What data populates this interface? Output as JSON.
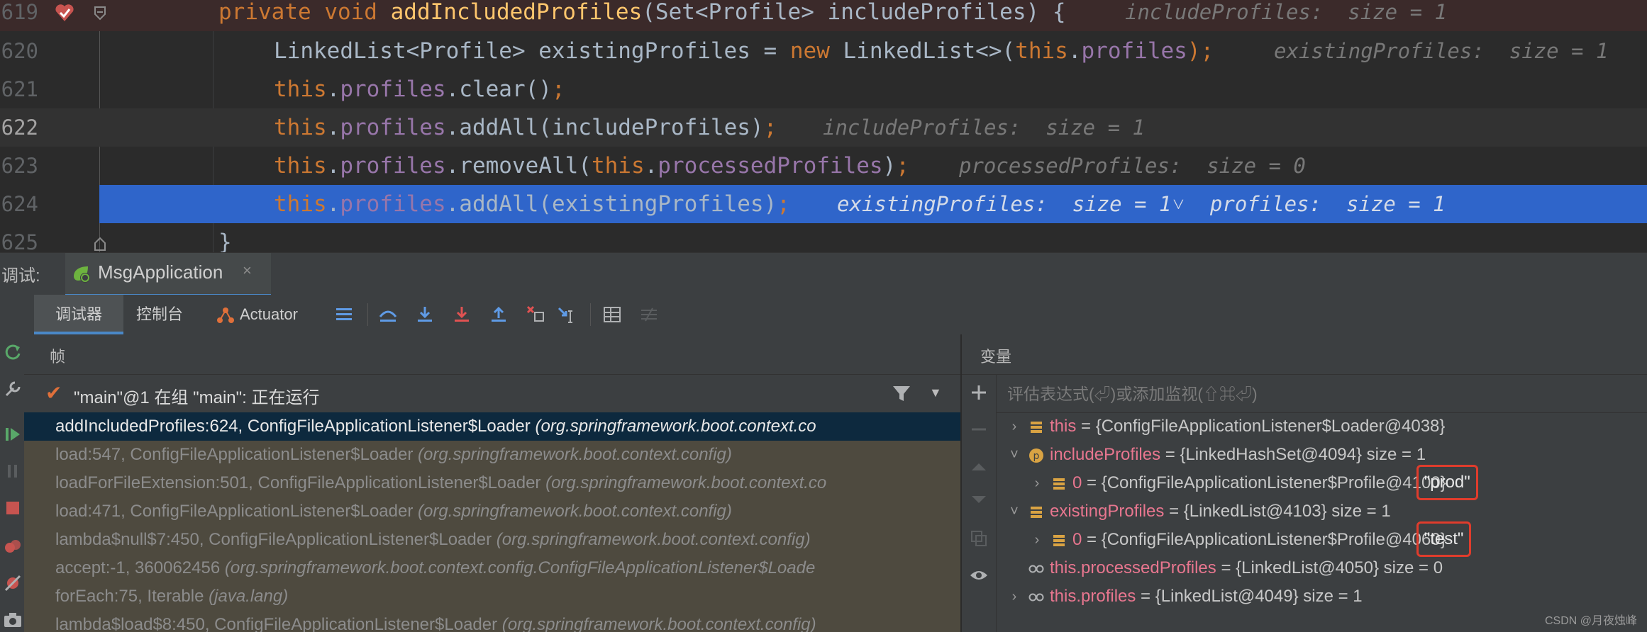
{
  "editor": {
    "lines": [
      {
        "num": "619",
        "code": [
          {
            "t": "private ",
            "c": "kw"
          },
          {
            "t": "void ",
            "c": "kw"
          },
          {
            "t": "addIncludedProfiles",
            "c": "fn"
          },
          {
            "t": "(Set<Profile> includeProfiles) {",
            "c": "plain"
          }
        ],
        "hint": "includeProfiles:  size = 1"
      },
      {
        "num": "620",
        "code": [
          {
            "t": "LinkedList<Profile> existingProfiles = ",
            "c": "plain"
          },
          {
            "t": "new ",
            "c": "kw"
          },
          {
            "t": "LinkedList<>(",
            "c": "plain"
          },
          {
            "t": "this",
            "c": "kw"
          },
          {
            "t": ".",
            "c": "plain"
          },
          {
            "t": "profiles",
            "c": "fld"
          },
          {
            "t": ");",
            "c": "kw"
          }
        ],
        "hint": "existingProfiles:  size = 1"
      },
      {
        "num": "621",
        "code": [
          {
            "t": "this",
            "c": "kw"
          },
          {
            "t": ".",
            "c": "plain"
          },
          {
            "t": "profiles",
            "c": "fld"
          },
          {
            "t": ".clear()",
            "c": "plain"
          },
          {
            "t": ";",
            "c": "kw"
          }
        ],
        "hint": ""
      },
      {
        "num": "622",
        "code": [
          {
            "t": "this",
            "c": "kw"
          },
          {
            "t": ".",
            "c": "plain"
          },
          {
            "t": "profiles",
            "c": "fld"
          },
          {
            "t": ".addAll(includeProfiles)",
            "c": "plain"
          },
          {
            "t": ";",
            "c": "kw"
          }
        ],
        "hint": "includeProfiles:  size = 1"
      },
      {
        "num": "623",
        "code": [
          {
            "t": "this",
            "c": "kw"
          },
          {
            "t": ".",
            "c": "plain"
          },
          {
            "t": "profiles",
            "c": "fld"
          },
          {
            "t": ".removeAll(",
            "c": "plain"
          },
          {
            "t": "this",
            "c": "kw"
          },
          {
            "t": ".",
            "c": "plain"
          },
          {
            "t": "processedProfiles",
            "c": "fld"
          },
          {
            "t": ")",
            "c": "plain"
          },
          {
            "t": ";",
            "c": "kw"
          }
        ],
        "hint": "processedProfiles:  size = 0"
      },
      {
        "num": "624",
        "code": [
          {
            "t": "this",
            "c": "kw"
          },
          {
            "t": ".",
            "c": "plain"
          },
          {
            "t": "profiles",
            "c": "fld"
          },
          {
            "t": ".addAll(existingProfiles)",
            "c": "plain"
          },
          {
            "t": ";",
            "c": "kw"
          }
        ],
        "hint": "existingProfiles:  size = 1˅  profiles:  size = 1"
      },
      {
        "num": "625",
        "code": [
          {
            "t": "}",
            "c": "plain"
          }
        ],
        "hint": ""
      }
    ]
  },
  "debug": {
    "label": "调试:",
    "session_tab": "MsgApplication",
    "session_close": "×",
    "tabs": {
      "debugger": "调试器",
      "console": "控制台",
      "actuator": "Actuator"
    }
  },
  "frames": {
    "title": "帧",
    "thread": "\"main\"@1 在组 \"main\": 正在运行",
    "items": [
      {
        "method": "addIncludedProfiles:624, ConfigFileApplicationListener$Loader",
        "pkg": "(org.springframework.boot.context.co"
      },
      {
        "method": "load:547, ConfigFileApplicationListener$Loader",
        "pkg": "(org.springframework.boot.context.config)"
      },
      {
        "method": "loadForFileExtension:501, ConfigFileApplicationListener$Loader",
        "pkg": "(org.springframework.boot.context.co"
      },
      {
        "method": "load:471, ConfigFileApplicationListener$Loader",
        "pkg": "(org.springframework.boot.context.config)"
      },
      {
        "method": "lambda$null$7:450, ConfigFileApplicationListener$Loader",
        "pkg": "(org.springframework.boot.context.config)"
      },
      {
        "method": "accept:-1, 360062456",
        "pkg": "(org.springframework.boot.context.config.ConfigFileApplicationListener$Loade"
      },
      {
        "method": "forEach:75, Iterable",
        "pkg": "(java.lang)"
      },
      {
        "method": "lambda$load$8:450, ConfigFileApplicationListener$Loader",
        "pkg": "(org.springframework.boot.context.config)"
      }
    ]
  },
  "variables": {
    "title": "变量",
    "eval_placeholder": "评估表达式(⏎)或添加监视(⇧⌘⏎)",
    "items": [
      {
        "name": "this",
        "value": " = {ConfigFileApplicationListener$Loader@4038}",
        "size": "",
        "twisty": "›",
        "icon": "field-icon"
      },
      {
        "name": "includeProfiles",
        "value": " = {LinkedHashSet@4094}",
        "size": "  size = 1",
        "twisty": "˅",
        "icon": "parameter-icon"
      },
      {
        "name": "0",
        "value": " = {ConfigFileApplicationListener$Profile@4100}",
        "size": "",
        "twisty": "›",
        "icon": "field-icon",
        "str": "\"prod\""
      },
      {
        "name": "existingProfiles",
        "value": " = {LinkedList@4103}",
        "size": "  size = 1",
        "twisty": "˅",
        "icon": "field-icon"
      },
      {
        "name": "0",
        "value": " = {ConfigFileApplicationListener$Profile@4060}",
        "size": "",
        "twisty": "›",
        "icon": "field-icon",
        "str": "\"test\""
      },
      {
        "name": "this.processedProfiles",
        "value": " = {LinkedList@4050}",
        "size": "  size = 0",
        "twisty": "",
        "icon": "watch-icon"
      },
      {
        "name": "this.profiles",
        "value": " = {LinkedList@4049}",
        "size": "  size = 1",
        "twisty": "›",
        "icon": "watch-icon"
      }
    ]
  },
  "watermark": "CSDN @月夜烛峰",
  "colors": {
    "selection": "#2f65ca",
    "keyword": "#cc7832",
    "method": "#ffc66d",
    "field": "#9876aa",
    "var_name": "#e8768f",
    "highlight_box": "#e03c2c"
  }
}
